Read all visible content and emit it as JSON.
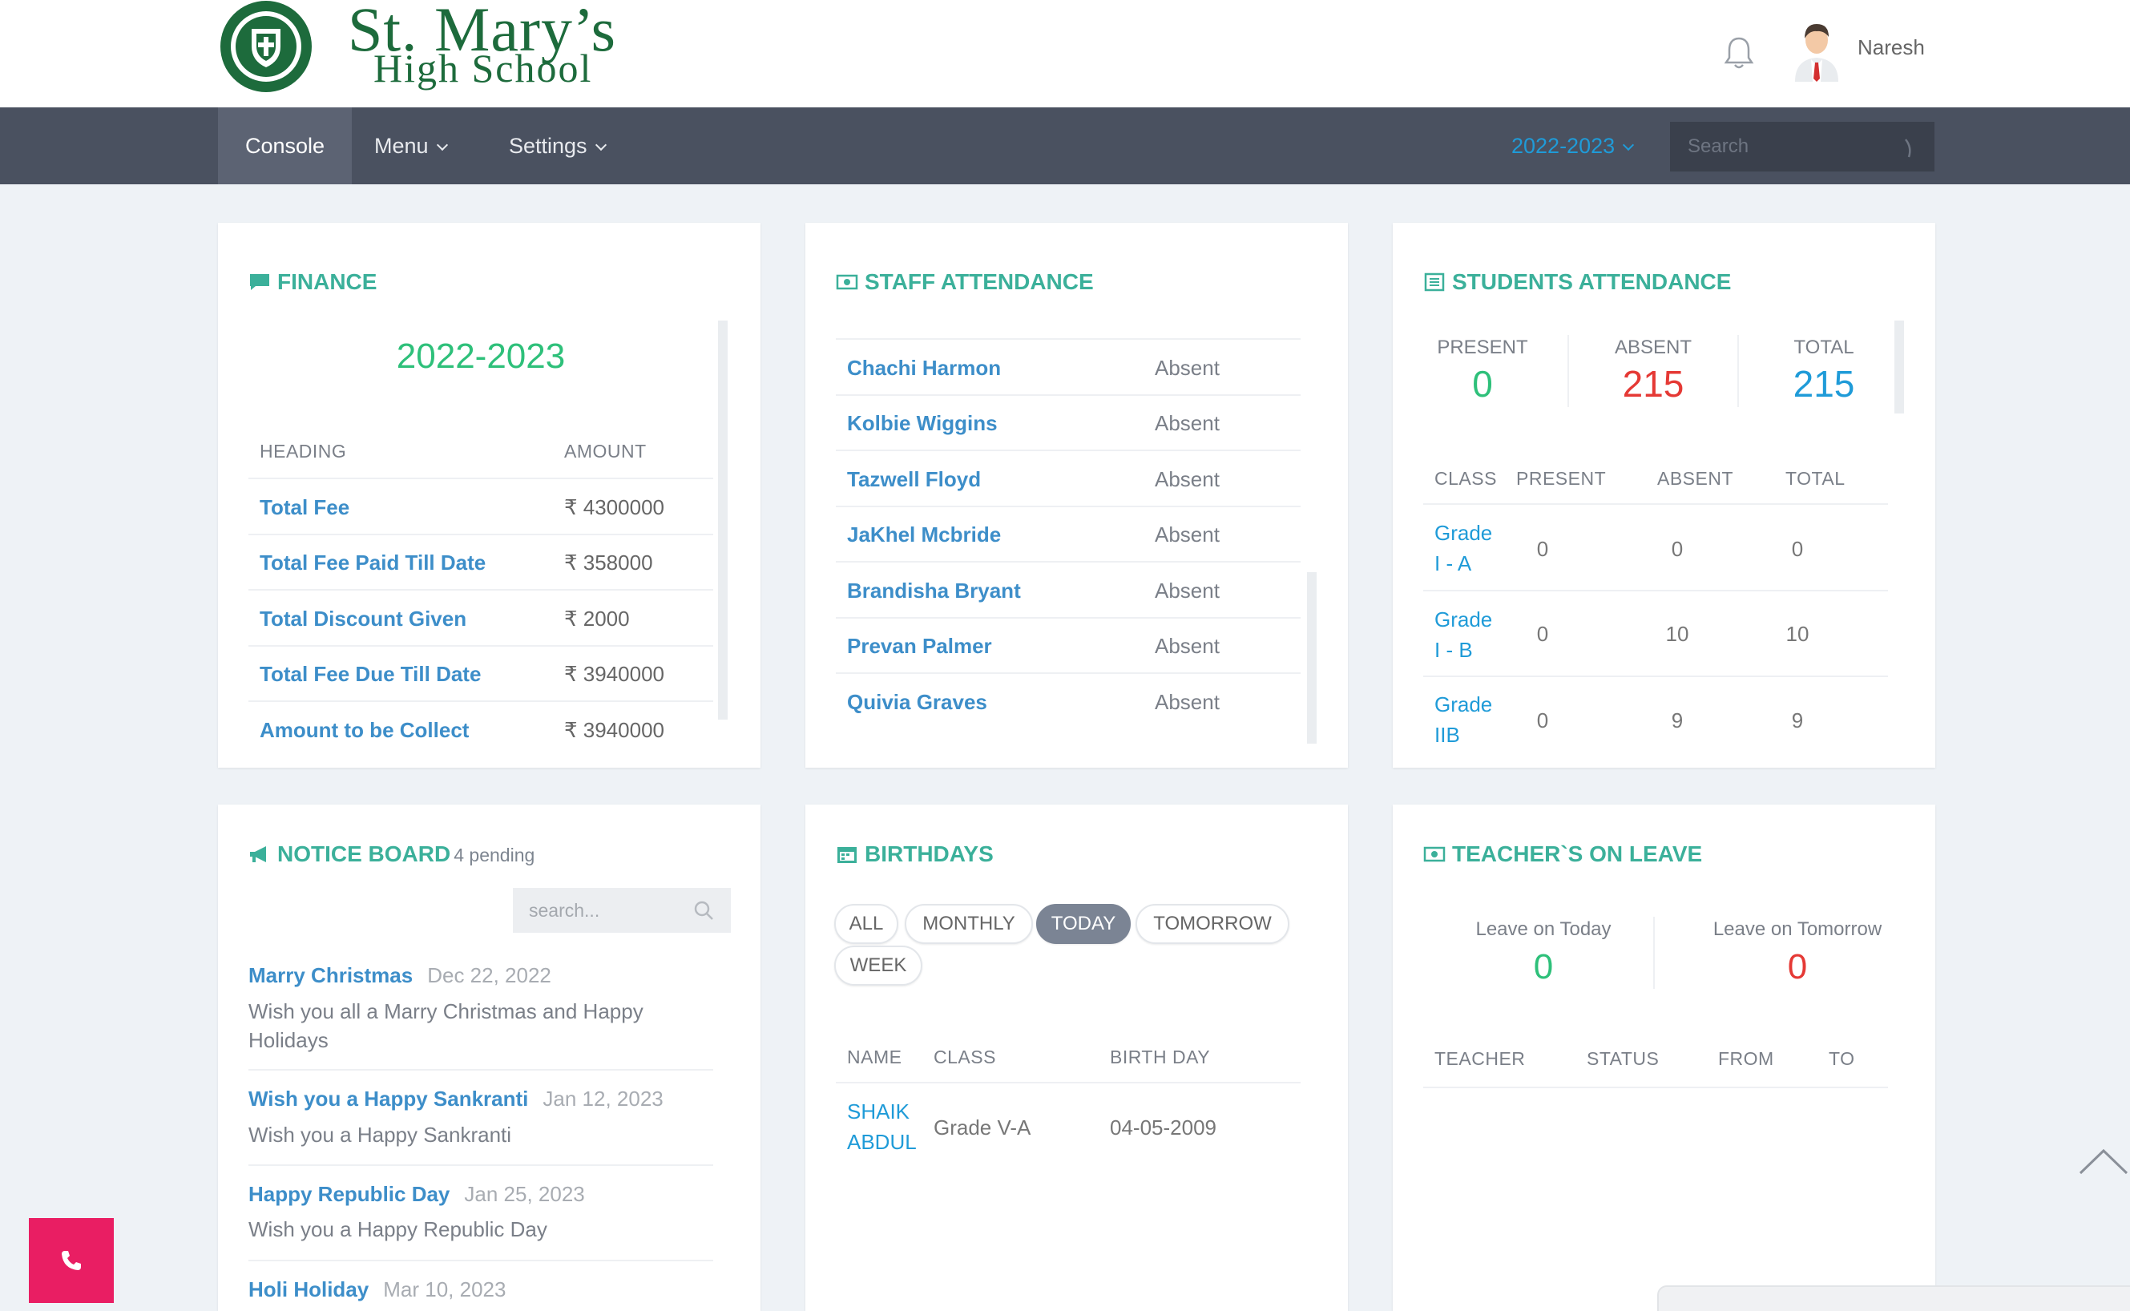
{
  "header": {
    "school_line1": "St. Mary’s",
    "school_line2": "High School",
    "username": "Naresh"
  },
  "nav": {
    "console": "Console",
    "menu": "Menu",
    "settings": "Settings",
    "year": "2022-2023",
    "search_placeholder": "Search"
  },
  "finance": {
    "title": "FINANCE",
    "year": "2022-2023",
    "col_heading": "HEADING",
    "col_amount": "AMOUNT",
    "rows": [
      {
        "label": "Total Fee",
        "amount": "₹ 4300000"
      },
      {
        "label": "Total Fee Paid Till Date",
        "amount": "₹ 358000"
      },
      {
        "label": "Total Discount Given",
        "amount": "₹ 2000"
      },
      {
        "label": "Total Fee Due Till Date",
        "amount": "₹ 3940000"
      },
      {
        "label": "Amount to be Collect",
        "amount": "₹ 3940000"
      }
    ]
  },
  "staff": {
    "title": "STAFF ATTENDANCE",
    "rows": [
      {
        "name": "Chachi Harmon",
        "status": "Absent"
      },
      {
        "name": "Kolbie Wiggins",
        "status": "Absent"
      },
      {
        "name": "Tazwell Floyd",
        "status": "Absent"
      },
      {
        "name": "JaKhel Mcbride",
        "status": "Absent"
      },
      {
        "name": "Brandisha Bryant",
        "status": "Absent"
      },
      {
        "name": "Prevan Palmer",
        "status": "Absent"
      },
      {
        "name": "Quivia Graves",
        "status": "Absent"
      }
    ]
  },
  "students": {
    "title": "STUDENTS ATTENDANCE",
    "present_label": "PRESENT",
    "present": "0",
    "absent_label": "ABSENT",
    "absent": "215",
    "total_label": "TOTAL",
    "total": "215",
    "col_class": "CLASS",
    "col_present": "PRESENT",
    "col_absent": "ABSENT",
    "col_total": "TOTAL",
    "rows": [
      {
        "class_line1": "Grade",
        "class_line2": "I - A",
        "present": "0",
        "absent": "0",
        "total": "0"
      },
      {
        "class_line1": "Grade",
        "class_line2": "I - B",
        "present": "0",
        "absent": "10",
        "total": "10"
      },
      {
        "class_line1": "Grade",
        "class_line2": "IIB",
        "present": "0",
        "absent": "9",
        "total": "9"
      }
    ]
  },
  "notice": {
    "title": "NOTICE BOARD",
    "pending": "4 pending",
    "search_placeholder": "search...",
    "items": [
      {
        "title": "Marry Christmas",
        "date": "Dec 22, 2022",
        "body": "Wish you all a Marry Christmas and Happy Holidays"
      },
      {
        "title": "Wish you a Happy Sankranti",
        "date": "Jan 12, 2023",
        "body": "Wish you a Happy Sankranti"
      },
      {
        "title": "Happy Republic Day",
        "date": "Jan 25, 2023",
        "body": "Wish you a Happy Republic Day"
      },
      {
        "title": "Holi Holiday",
        "date": "Mar 10, 2023",
        "body": ""
      }
    ]
  },
  "birthdays": {
    "title": "BIRTHDAYS",
    "filters": [
      "ALL",
      "MONTHLY",
      "TODAY",
      "TOMORROW",
      "WEEK"
    ],
    "active_filter": "TODAY",
    "col_name": "NAME",
    "col_class": "CLASS",
    "col_birthday": "BIRTH DAY",
    "rows": [
      {
        "name_line1": "SHAIK",
        "name_line2": "ABDUL",
        "class": "Grade V-A",
        "birthday": "04-05-2009"
      }
    ]
  },
  "leave": {
    "title": "TEACHER`S ON LEAVE",
    "today_label": "Leave on Today",
    "today": "0",
    "tomorrow_label": "Leave on Tomorrow",
    "tomorrow": "0",
    "col_teacher": "TEACHER",
    "col_status": "STATUS",
    "col_from": "FROM",
    "col_to": "TO"
  },
  "colors": {
    "green": "#2ec07a",
    "red": "#e53935",
    "blue": "#1f9bd8",
    "teal": "#3bb09a",
    "nav": "#4a5160",
    "call": "#e91e63"
  },
  "icons": [
    "bell-icon",
    "search-icon",
    "chat-icon",
    "money-icon",
    "list-icon",
    "megaphone-icon",
    "calendar-icon",
    "phone-icon",
    "chevron-up-icon"
  ]
}
